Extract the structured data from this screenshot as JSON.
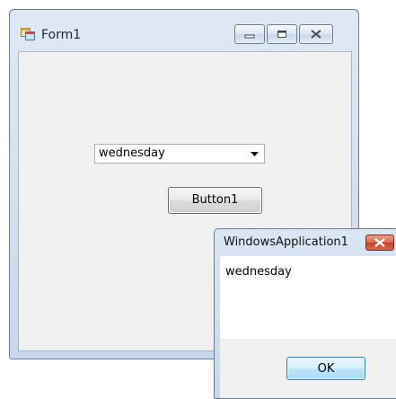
{
  "form1": {
    "title": "Form1",
    "combobox": {
      "selected": "wednesday"
    },
    "button_label": "Button1"
  },
  "messagebox": {
    "title": "WindowsApplication1",
    "message": "wednesday",
    "ok_label": "OK"
  },
  "icons": [
    "app-icon",
    "minimize-icon",
    "maximize-icon",
    "close-icon",
    "chevron-down-icon"
  ]
}
